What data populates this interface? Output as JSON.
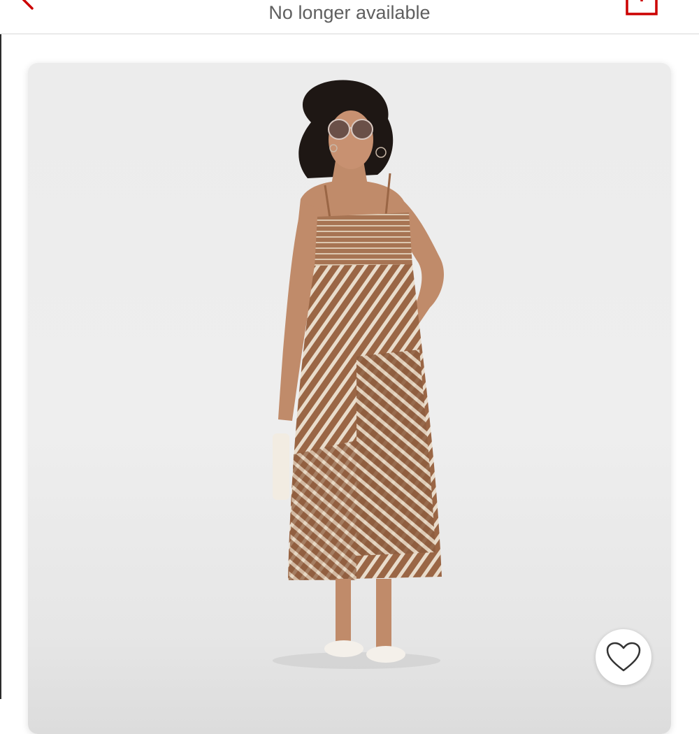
{
  "header": {
    "title": "No longer available",
    "back_icon": "chevron-left-icon",
    "share_icon": "share-icon",
    "accent_color": "#cc0000"
  },
  "product": {
    "image_subject": "model wearing a brown geometric-striped smocked maxi dress",
    "favorite_icon": "heart-outline-icon"
  }
}
